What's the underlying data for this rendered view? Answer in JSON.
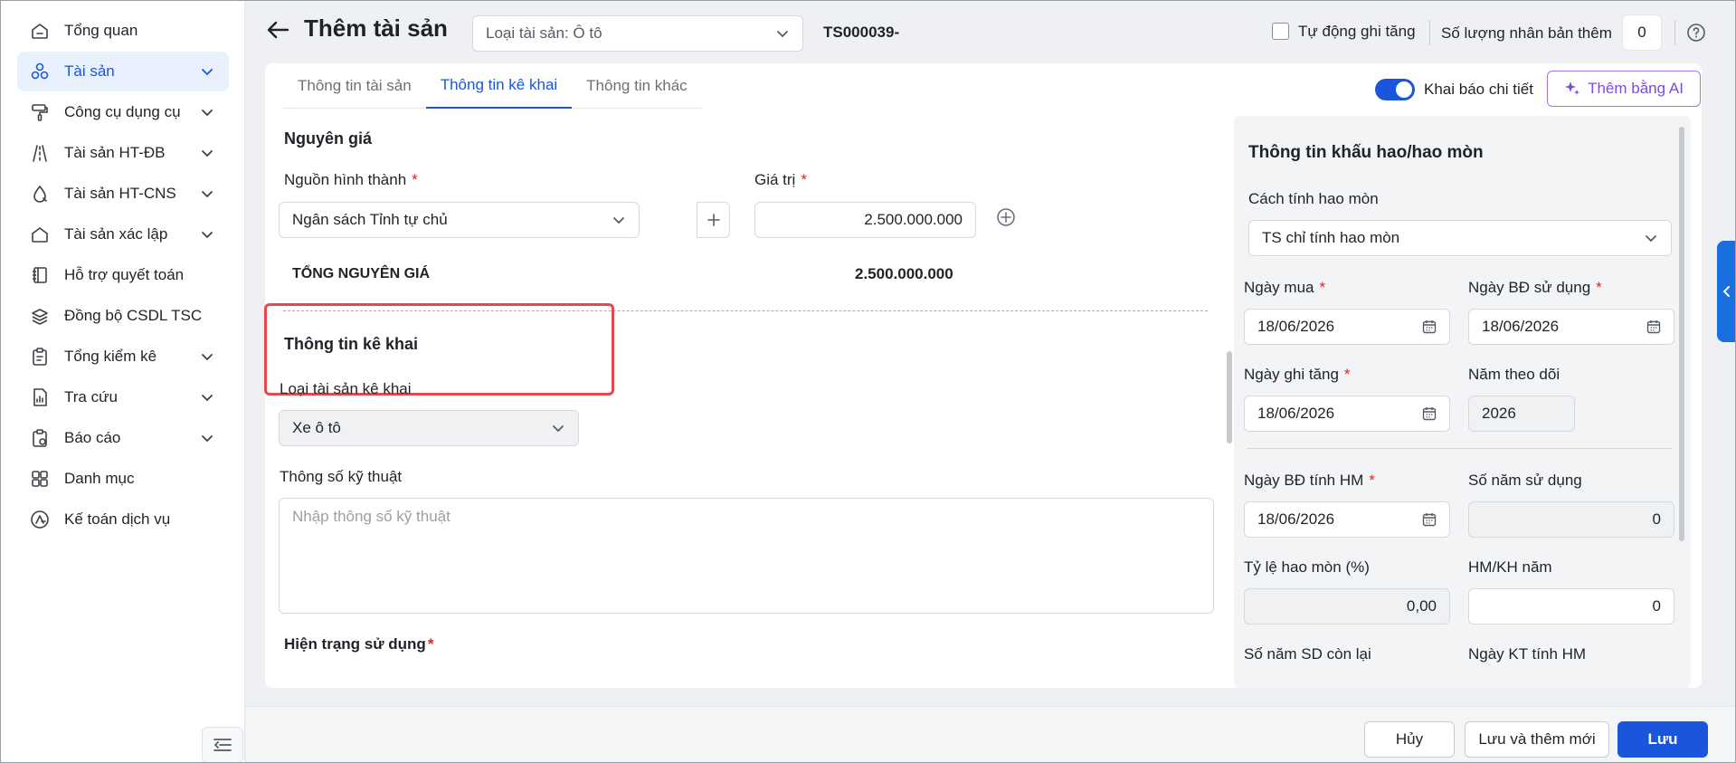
{
  "sidebar": {
    "items": [
      {
        "label": "Tổng quan",
        "icon": "home-icon",
        "chevron": false,
        "active": false
      },
      {
        "label": "Tài sản",
        "icon": "assets-icon",
        "chevron": true,
        "active": true
      },
      {
        "label": "Công cụ dụng cụ",
        "icon": "paint-roller-icon",
        "chevron": true,
        "active": false
      },
      {
        "label": "Tài sản HT-ĐB",
        "icon": "road-icon",
        "chevron": true,
        "active": false
      },
      {
        "label": "Tài sản HT-CNS",
        "icon": "water-drop-icon",
        "chevron": true,
        "active": false
      },
      {
        "label": "Tài sản xác lập",
        "icon": "house-icon",
        "chevron": true,
        "active": false
      },
      {
        "label": "Hỗ trợ quyết toán",
        "icon": "ledger-icon",
        "chevron": false,
        "active": false
      },
      {
        "label": "Đồng bộ CSDL TSC",
        "icon": "layers-sync-icon",
        "chevron": false,
        "active": false
      },
      {
        "label": "Tổng kiểm kê",
        "icon": "clipboard-icon",
        "chevron": true,
        "active": false
      },
      {
        "label": "Tra cứu",
        "icon": "document-chart-icon",
        "chevron": true,
        "active": false
      },
      {
        "label": "Báo cáo",
        "icon": "report-icon",
        "chevron": true,
        "active": false
      },
      {
        "label": "Danh mục",
        "icon": "grid-icon",
        "chevron": false,
        "active": false
      },
      {
        "label": "Kế toán dịch vụ",
        "icon": "accounting-service-icon",
        "chevron": false,
        "active": false
      }
    ]
  },
  "header": {
    "title": "Thêm tài sản",
    "asset_type": "Loại tài sản: Ô tô",
    "asset_code": "TS000039-",
    "auto_increase_label": "Tự động ghi tăng",
    "duplicate_label": "Số lượng nhân bản thêm",
    "duplicate_value": "0"
  },
  "tabs": [
    {
      "label": "Thông tin tài sản",
      "active": false
    },
    {
      "label": "Thông tin kê khai",
      "active": true
    },
    {
      "label": "Thông tin khác",
      "active": false
    }
  ],
  "toolbar": {
    "detail_toggle_label": "Khai báo chi tiết",
    "ai_button_label": "Thêm bằng AI"
  },
  "original_cost": {
    "section_title": "Nguyên giá",
    "source_label": "Nguồn hình thành",
    "source_value": "Ngân sách Tỉnh tự chủ",
    "value_label": "Giá trị",
    "value": "2.500.000.000",
    "total_label": "TỔNG NGUYÊN GIÁ",
    "total_value": "2.500.000.000"
  },
  "declaration": {
    "section_title": "Thông tin kê khai",
    "declared_type_label": "Loại tài sản kê khai",
    "declared_type_value": "Xe ô tô",
    "specs_label": "Thông số kỹ thuật",
    "specs_placeholder": "Nhập thông số kỹ thuật",
    "usage_status_label": "Hiện trạng sử dụng"
  },
  "depreciation": {
    "title": "Thông tin khấu hao/hao mòn",
    "method_label": "Cách tính hao mòn",
    "method_value": "TS chỉ tính hao mòn",
    "purchase_date_label": "Ngày mua",
    "purchase_date": "18/06/2026",
    "start_use_label": "Ngày BĐ sử dụng",
    "start_use_date": "18/06/2026",
    "record_date_label": "Ngày ghi tăng",
    "record_date": "18/06/2026",
    "tracking_year_label": "Năm theo dõi",
    "tracking_year": "2026",
    "dep_start_label": "Ngày BĐ tính HM",
    "dep_start_date": "18/06/2026",
    "years_use_label": "Số năm sử dụng",
    "years_use": "0",
    "rate_label": "Tỷ lệ hao mòn (%)",
    "rate": "0,00",
    "annual_label": "HM/KH năm",
    "annual": "0",
    "remaining_label": "Số năm SD còn lại",
    "end_date_label": "Ngày KT tính HM"
  },
  "footer": {
    "cancel_label": "Hủy",
    "save_new_label": "Lưu và thêm mới",
    "save_label": "Lưu"
  }
}
